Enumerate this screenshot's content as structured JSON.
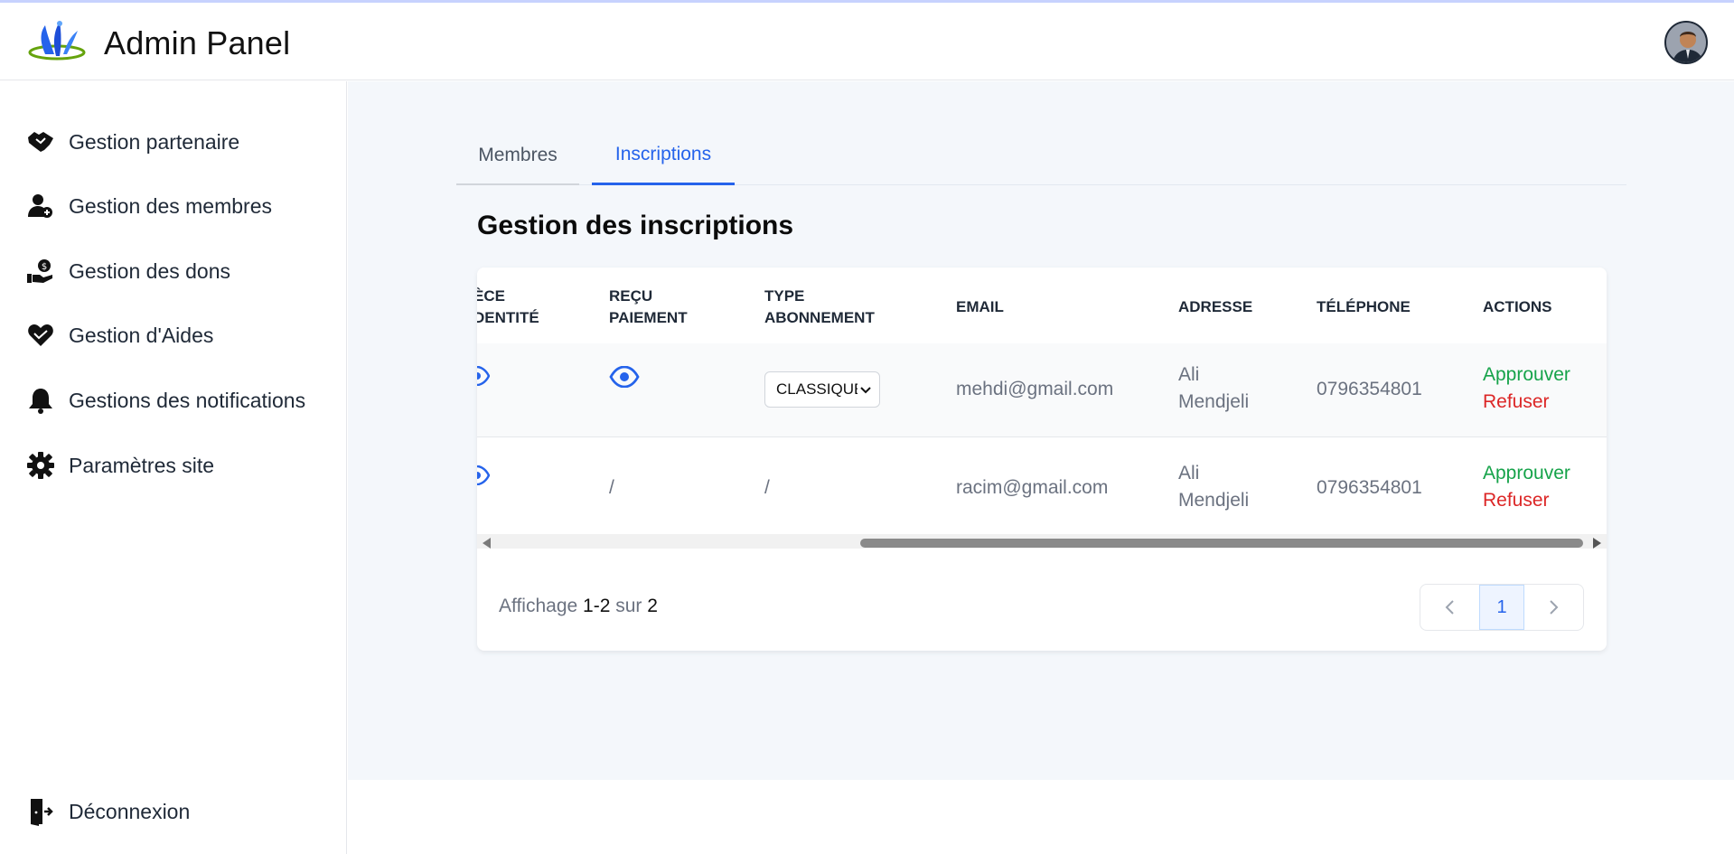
{
  "header": {
    "title": "Admin Panel"
  },
  "sidebar": {
    "items": [
      {
        "label": "Gestion partenaire",
        "icon": "handshake-icon"
      },
      {
        "label": "Gestion des membres",
        "icon": "user-plus-icon"
      },
      {
        "label": "Gestion des dons",
        "icon": "hand-coin-icon"
      },
      {
        "label": "Gestion d'Aides",
        "icon": "hand-heart-icon"
      },
      {
        "label": "Gestions des notifications",
        "icon": "bell-icon"
      },
      {
        "label": "Paramètres site",
        "icon": "gear-icon"
      }
    ],
    "logout": {
      "label": "Déconnexion",
      "icon": "logout-icon"
    }
  },
  "tabs": [
    {
      "label": "Membres",
      "active": false
    },
    {
      "label": "Inscriptions",
      "active": true
    }
  ],
  "section": {
    "title": "Gestion des inscriptions"
  },
  "table": {
    "columns": {
      "piece_identite_line1": "ÈCE",
      "piece_identite_line2": "DENTITÉ",
      "recu_line1": "REÇU",
      "recu_line2": "PAIEMENT",
      "type_line1": "TYPE",
      "type_line2": "ABONNEMENT",
      "email": "EMAIL",
      "adresse": "ADRESSE",
      "telephone": "TÉLÉPHONE",
      "actions": "ACTIONS"
    },
    "rows": [
      {
        "recu": "eye-icon",
        "type": "CLASSIQUE",
        "email": "mehdi@gmail.com",
        "adresse_line1": "Ali",
        "adresse_line2": "Mendjeli",
        "telephone": "0796354801",
        "approve": "Approuver",
        "refuse": "Refuser"
      },
      {
        "recu": "/",
        "type": "/",
        "email": "racim@gmail.com",
        "adresse_line1": "Ali",
        "adresse_line2": "Mendjeli",
        "telephone": "0796354801",
        "approve": "Approuver",
        "refuse": "Refuser"
      }
    ]
  },
  "pagination": {
    "prefix": "Affichage",
    "from": "1",
    "dash": "-",
    "to": "2",
    "of": "sur",
    "total": "2",
    "current_page": "1"
  },
  "colors": {
    "accent": "#2563eb",
    "approve": "#16a34a",
    "refuse": "#dc2626",
    "main_bg": "#f4f7fb"
  }
}
